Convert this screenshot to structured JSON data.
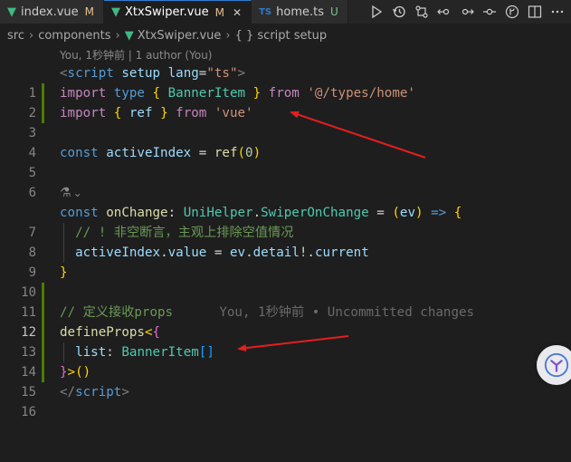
{
  "tabs": [
    {
      "label": "index.vue",
      "status": "M",
      "icon": "vue-icon",
      "active": false
    },
    {
      "label": "XtxSwiper.vue",
      "status": "M",
      "icon": "vue-icon",
      "active": true
    },
    {
      "label": "home.ts",
      "status": "U",
      "icon": "ts-icon",
      "active": false
    }
  ],
  "tab_icon_ts": "TS",
  "breadcrumb": [
    "src",
    "components",
    "XtxSwiper.vue",
    "{ } script setup"
  ],
  "blame_header": "You, 1秒钟前 | 1 author (You)",
  "line_numbers": [
    "1",
    "2",
    "3",
    "4",
    "5",
    "6",
    "7",
    "8",
    "9",
    "10",
    "11",
    "12",
    "13",
    "14",
    "15",
    "16"
  ],
  "current_line": "12",
  "modified_lines": [
    "2",
    "3",
    "12",
    "13",
    "14",
    "15"
  ],
  "code": {
    "l1": {
      "open": "<",
      "tag": "script",
      "attr1": "setup",
      "attr2": "lang",
      "eq": "=",
      "val": "\"ts\"",
      "close": ">"
    },
    "l2": {
      "kw": "import",
      "type": "type",
      "lb": "{",
      "name": "BannerItem",
      "rb": "}",
      "from": "from",
      "src": "'@/types/home'"
    },
    "l3": {
      "kw": "import",
      "lb": "{",
      "name": "ref",
      "rb": "}",
      "from": "from",
      "src": "'vue'"
    },
    "l5": {
      "kw": "const",
      "name": "activeIndex",
      "eq": "=",
      "fn": "ref",
      "lp": "(",
      "num": "0",
      "rp": ")"
    },
    "l7": {
      "lens": "⚗",
      "chev": "⌄"
    },
    "l7_glyph": "codelens",
    "l8": {
      "kw": "const",
      "name": "onChange",
      "colon": ":",
      "ns": "UniHelper",
      "dot": ".",
      "type": "SwiperOnChange",
      "eq": "=",
      "lp": "(",
      "param": "ev",
      "rp": ")",
      "arrow": "=>",
      "lb": "{"
    },
    "l9": {
      "comment": "// ! 非空断言，主观上排除空值情况"
    },
    "l10": {
      "obj": "activeIndex",
      "dot1": ".",
      "prop": "value",
      "eq": "=",
      "ev": "ev",
      "dot2": ".",
      "detail": "detail",
      "bang": "!",
      "dot3": ".",
      "current": "current"
    },
    "l11": {
      "rb": "}"
    },
    "l13": {
      "comment": "// 定义接收props",
      "blame": "You, 1秒钟前 • Uncommitted changes"
    },
    "l14": {
      "fn": "defineProps",
      "lt": "<",
      "lb": "{"
    },
    "l15": {
      "key": "list",
      "colon": ":",
      "type": "BannerItem",
      "arr": "[]"
    },
    "l16": {
      "rb": "}",
      "gt": ">",
      "lp": "(",
      "rp": ")"
    },
    "l17": {
      "open": "</",
      "tag": "script",
      "close": ">"
    }
  },
  "toolbar_icons": [
    "run-icon",
    "history-icon",
    "git-compare-icon",
    "arrow-left-icon",
    "arrow-right-icon",
    "git-commit-icon",
    "source-control-icon",
    "split-editor-icon",
    "more-icon"
  ],
  "colors": {
    "background": "#1e1e1e",
    "keyword": "#569cd6",
    "control_keyword": "#c586c0",
    "type": "#4ec9b0",
    "string": "#ce9178",
    "comment": "#6a9955",
    "arrow_annotation": "#e51e1e",
    "gutter_modified": "#487e02"
  }
}
